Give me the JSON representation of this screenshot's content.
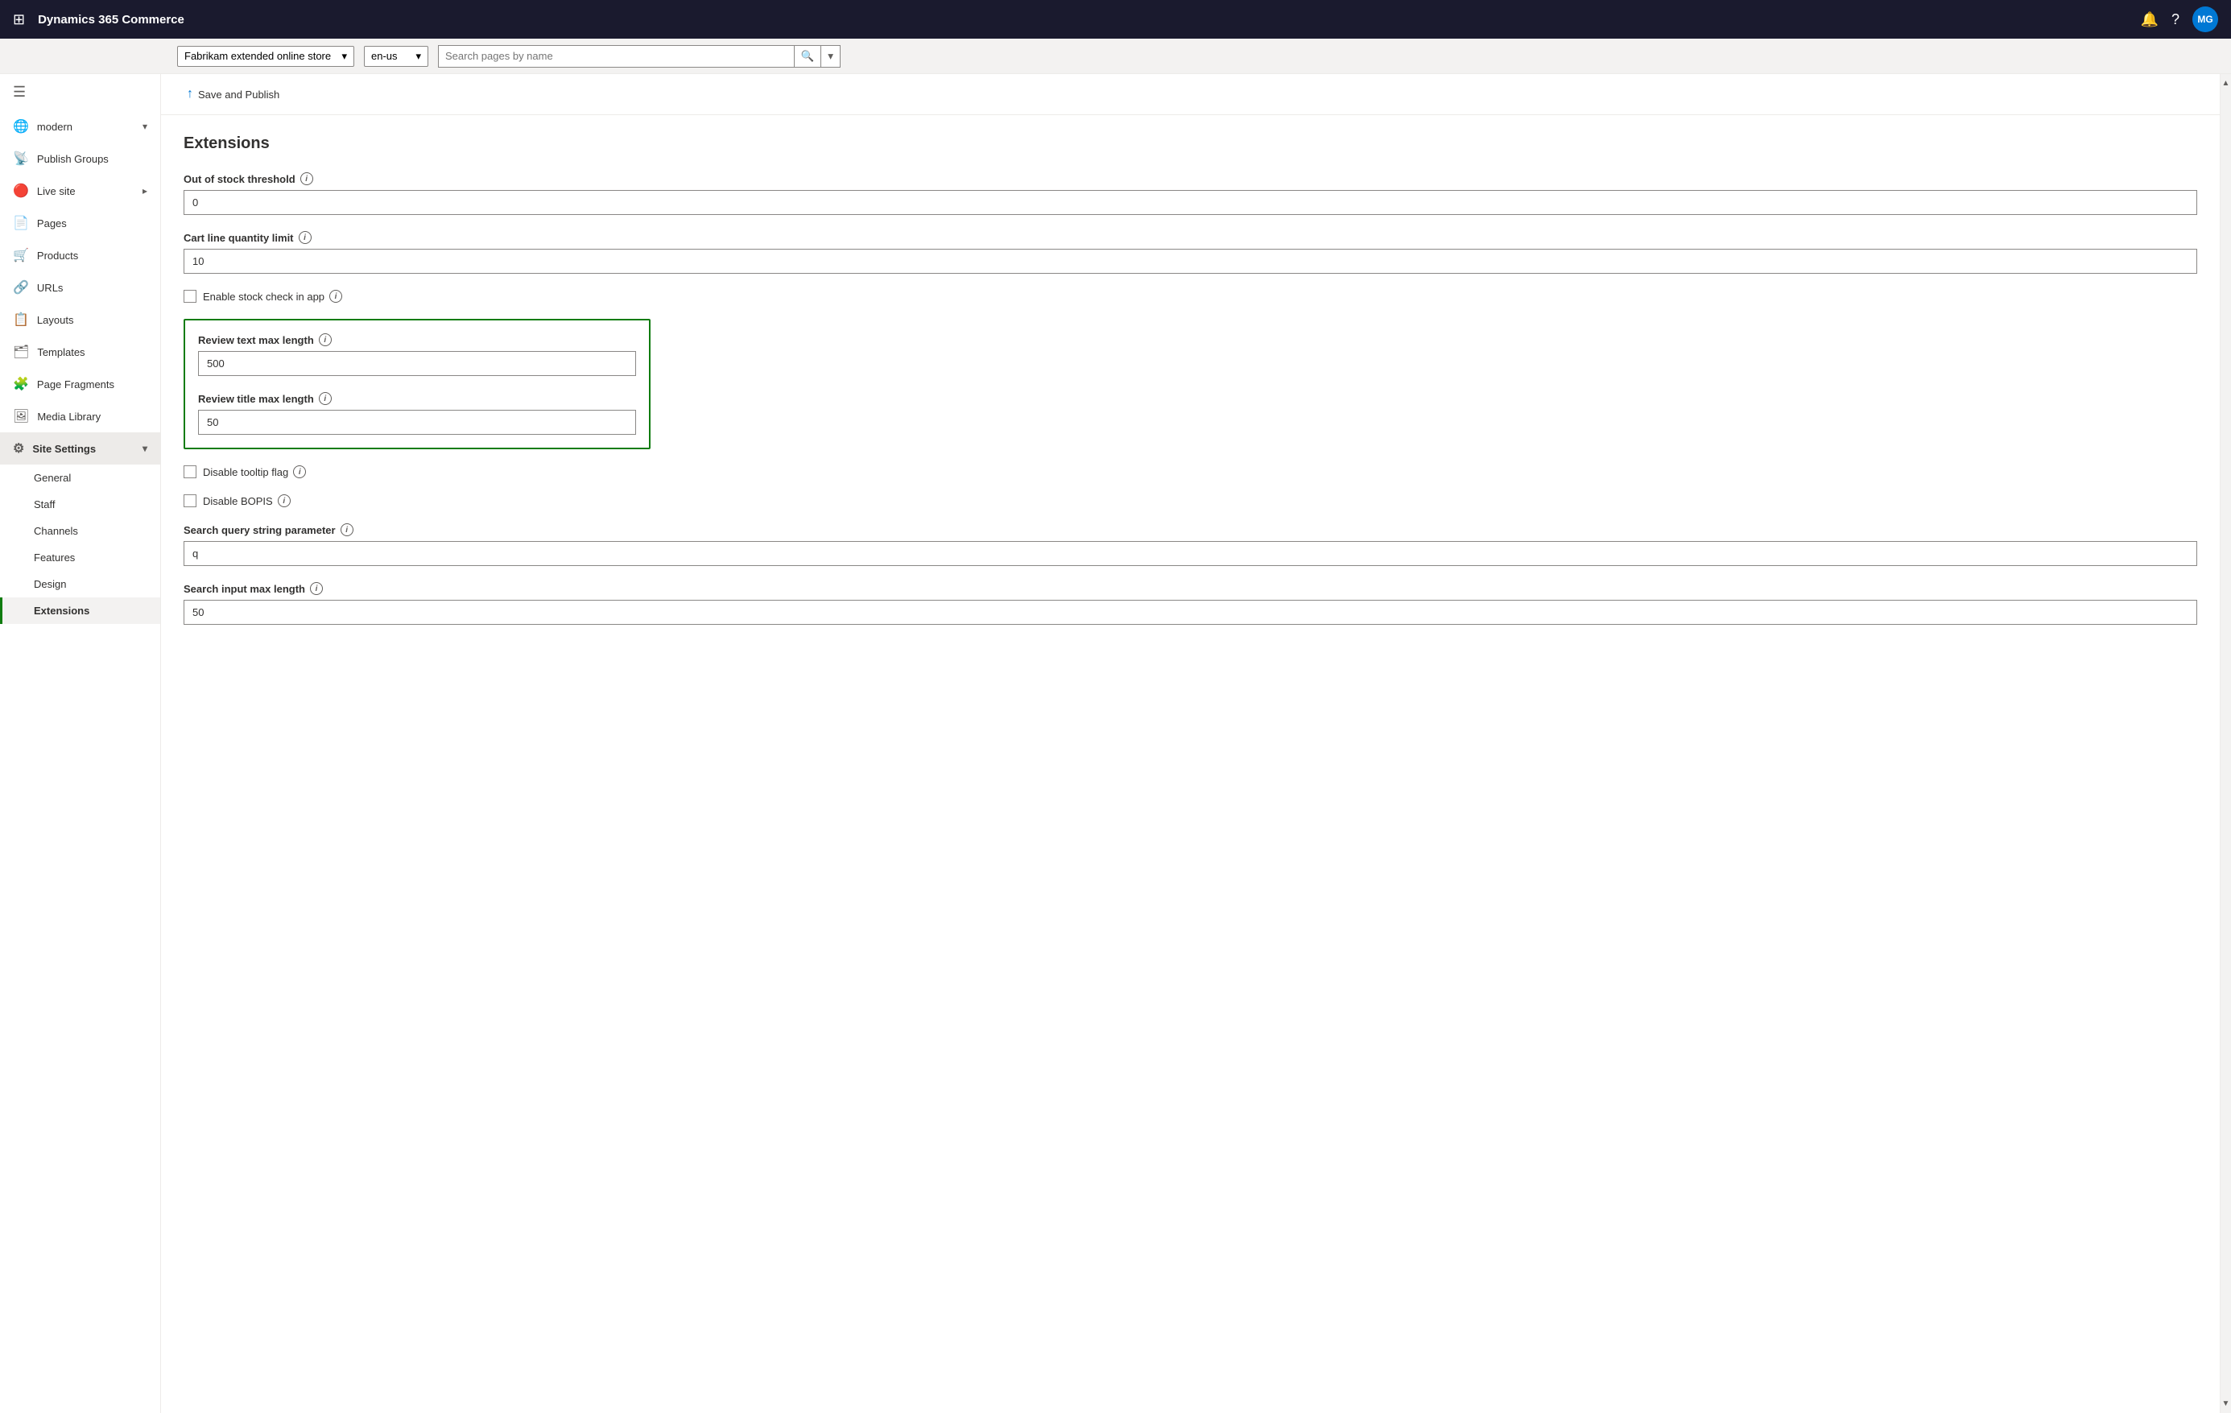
{
  "app": {
    "title": "Dynamics 365 Commerce",
    "avatar_initials": "MG",
    "avatar_color": "#0078d4"
  },
  "sub_header": {
    "store": {
      "value": "Fabrikam extended online store",
      "options": [
        "Fabrikam extended online store"
      ]
    },
    "language": {
      "value": "en-us",
      "options": [
        "en-us"
      ]
    },
    "search": {
      "placeholder": "Search pages by name"
    }
  },
  "sidebar": {
    "menu_icon": "☰",
    "items": [
      {
        "id": "modern",
        "label": "modern",
        "icon": "🌐",
        "expandable": true,
        "expanded": true
      },
      {
        "id": "publish-groups",
        "label": "Publish Groups",
        "icon": "📡",
        "expandable": false
      },
      {
        "id": "live-site",
        "label": "Live site",
        "icon": "🔴",
        "expandable": true,
        "expanded": false
      },
      {
        "id": "pages",
        "label": "Pages",
        "icon": "📄",
        "expandable": false
      },
      {
        "id": "products",
        "label": "Products",
        "icon": "🛒",
        "expandable": false
      },
      {
        "id": "urls",
        "label": "URLs",
        "icon": "🔗",
        "expandable": false
      },
      {
        "id": "layouts",
        "label": "Layouts",
        "icon": "📋",
        "expandable": false
      },
      {
        "id": "templates",
        "label": "Templates",
        "icon": "🗂",
        "expandable": false
      },
      {
        "id": "page-fragments",
        "label": "Page Fragments",
        "icon": "🧩",
        "expandable": false
      },
      {
        "id": "media-library",
        "label": "Media Library",
        "icon": "🖼",
        "expandable": false
      },
      {
        "id": "site-settings",
        "label": "Site Settings",
        "icon": "⚙",
        "expandable": true,
        "expanded": true
      }
    ],
    "site_settings_subitems": [
      {
        "id": "general",
        "label": "General"
      },
      {
        "id": "staff",
        "label": "Staff"
      },
      {
        "id": "channels",
        "label": "Channels"
      },
      {
        "id": "features",
        "label": "Features"
      },
      {
        "id": "design",
        "label": "Design"
      },
      {
        "id": "extensions",
        "label": "Extensions",
        "active": true
      }
    ]
  },
  "toolbar": {
    "save_publish_label": "Save and Publish",
    "save_icon": "↑"
  },
  "content": {
    "title": "Extensions",
    "fields": [
      {
        "id": "out-of-stock-threshold",
        "label": "Out of stock threshold",
        "has_info": true,
        "type": "text",
        "value": "0"
      },
      {
        "id": "cart-line-quantity-limit",
        "label": "Cart line quantity limit",
        "has_info": true,
        "type": "text",
        "value": "10"
      }
    ],
    "enable_stock_check": {
      "label": "Enable stock check in app",
      "has_info": true,
      "checked": false
    },
    "green_section": {
      "review_text_max_length": {
        "label": "Review text max length",
        "has_info": true,
        "value": "500"
      },
      "review_title_max_length": {
        "label": "Review title max length",
        "has_info": true,
        "value": "50"
      }
    },
    "disable_tooltip": {
      "label": "Disable tooltip flag",
      "has_info": true,
      "checked": false
    },
    "disable_bopis": {
      "label": "Disable BOPIS",
      "has_info": true,
      "checked": false
    },
    "search_query_string": {
      "label": "Search query string parameter",
      "has_info": true,
      "value": "q"
    },
    "search_input_max_length": {
      "label": "Search input max length",
      "has_info": true,
      "value": "50"
    }
  }
}
